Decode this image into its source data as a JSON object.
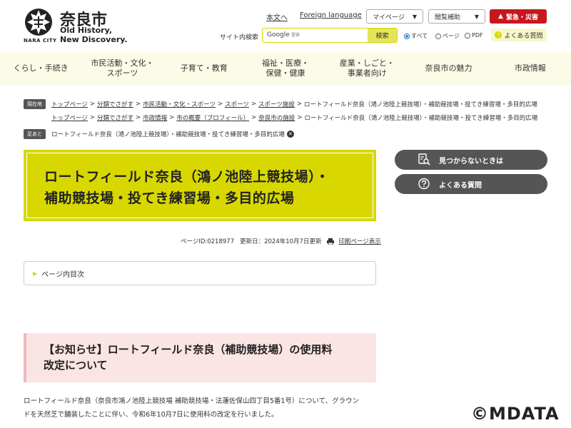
{
  "header": {
    "city_name": "奈良市",
    "city_romaji": "NARA CITY",
    "tagline_1": "Old History,",
    "tagline_2": "New Discovery.",
    "link_easy": "本文へ",
    "link_foreign": "Foreign language",
    "mypage_label": "マイページ",
    "access_label": "閲覧補助",
    "emergency_label": "緊急・災害",
    "search_label": "サイト内検索",
    "search_google": "Google",
    "search_placeholder": "提供",
    "search_button": "検索",
    "radio_all": "すべて",
    "radio_page": "ページ",
    "radio_pdf": "PDF",
    "faq_label": "よくある質問",
    "accent_color": "#d8d800",
    "emergency_color": "#c8161d"
  },
  "nav": [
    {
      "label": "くらし・手続き"
    },
    {
      "label": "市民活動・文化・\nスポーツ"
    },
    {
      "label": "子育て・教育"
    },
    {
      "label": "福祉・医療・\n保健・健康"
    },
    {
      "label": "産業・しごと・\n事業者向け"
    },
    {
      "label": "奈良市の魅力"
    },
    {
      "label": "市政情報"
    }
  ],
  "breadcrumbs": {
    "current_tag": "現在地",
    "row1": [
      "トップページ",
      "分類でさがす",
      "市民活動・文化・スポーツ",
      "スポーツ",
      "スポーツ施設"
    ],
    "row1_current": "ロートフィールド奈良（鴻ノ池陸上競技場）・補助競技場・投てき練習場・多目的広場",
    "row2": [
      "トップページ",
      "分類でさがす",
      "市政情報",
      "市の概要（プロフィール）",
      "奈良市の施設"
    ],
    "row2_current": "ロートフィールド奈良（鴻ノ池陸上競技場）・補助競技場・投てき練習場・多目的広場",
    "trail_tag": "足あと",
    "trail_item": "ロートフィールド奈良（鴻ノ池陸上競技場）・補助競技場・投てき練習場・多目的広場"
  },
  "main": {
    "title_line1": "ロートフィールド奈良（鴻ノ池陸上競技場）・",
    "title_line2": "補助競技場・投てき練習場・多目的広場",
    "page_id": "ページID:0218977",
    "updated": "更新日：2024年10月7日更新",
    "print_label": "印刷ページ表示",
    "toc_label": "ページ内目次",
    "notice_line1": "【お知らせ】ロートフィールド奈良（補助競技場）の使用料",
    "notice_line2": "改定について",
    "body_line1": "ロートフィールド奈良（奈良市鴻ノ池陸上競技場 補助競技場・法蓮佐保山四丁目5番1号）について、グラウン",
    "body_line2": "ドを天然芝で舗装したことに伴い、令和6年10月7日に使用料の改定を行いました。"
  },
  "sidebar": {
    "not_found": "見つからないときは",
    "faq": "よくある質問"
  },
  "watermark": "©MDATA"
}
